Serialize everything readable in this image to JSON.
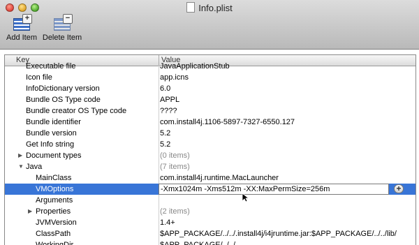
{
  "window": {
    "title": "Info.plist"
  },
  "toolbar": {
    "add_label": "Add Item",
    "delete_label": "Delete Item"
  },
  "columns": {
    "key": "Key",
    "value": "Value"
  },
  "rows": [
    {
      "key": "Executable file",
      "value": "JavaApplicationStub",
      "indent": 0,
      "disclosure": "",
      "dim": false
    },
    {
      "key": "Icon file",
      "value": "app.icns",
      "indent": 0,
      "disclosure": "",
      "dim": false
    },
    {
      "key": "InfoDictionary version",
      "value": "6.0",
      "indent": 0,
      "disclosure": "",
      "dim": false
    },
    {
      "key": "Bundle OS Type code",
      "value": "APPL",
      "indent": 0,
      "disclosure": "",
      "dim": false
    },
    {
      "key": "Bundle creator OS Type code",
      "value": "????",
      "indent": 0,
      "disclosure": "",
      "dim": false
    },
    {
      "key": "Bundle identifier",
      "value": "com.install4j.1106-5897-7327-6550.127",
      "indent": 0,
      "disclosure": "",
      "dim": false
    },
    {
      "key": "Bundle version",
      "value": "5.2",
      "indent": 0,
      "disclosure": "",
      "dim": false
    },
    {
      "key": "Get Info string",
      "value": " 5.2",
      "indent": 0,
      "disclosure": "",
      "dim": false
    },
    {
      "key": "Document types",
      "value": "(0 items)",
      "indent": 0,
      "disclosure": "collapsed",
      "dim": true
    },
    {
      "key": "Java",
      "value": "(7 items)",
      "indent": 0,
      "disclosure": "expanded",
      "dim": true
    },
    {
      "key": "MainClass",
      "value": "com.install4j.runtime.MacLauncher",
      "indent": 1,
      "disclosure": "",
      "dim": false
    },
    {
      "key": "VMOptions",
      "value": "-Xmx1024m -Xms512m -XX:MaxPermSize=256m",
      "indent": 1,
      "disclosure": "",
      "dim": false,
      "selected": true
    },
    {
      "key": "Arguments",
      "value": "",
      "indent": 1,
      "disclosure": "",
      "dim": false
    },
    {
      "key": "Properties",
      "value": "(2 items)",
      "indent": 1,
      "disclosure": "collapsed",
      "dim": true
    },
    {
      "key": "JVMVersion",
      "value": "1.4+",
      "indent": 1,
      "disclosure": "",
      "dim": false
    },
    {
      "key": "ClassPath",
      "value": "$APP_PACKAGE/../../.install4j/i4jruntime.jar:$APP_PACKAGE/../../lib/",
      "indent": 1,
      "disclosure": "",
      "dim": false
    },
    {
      "key": "WorkingDir",
      "value": "$APP_PACKAGE/../../..",
      "indent": 1,
      "disclosure": "",
      "dim": false
    }
  ]
}
